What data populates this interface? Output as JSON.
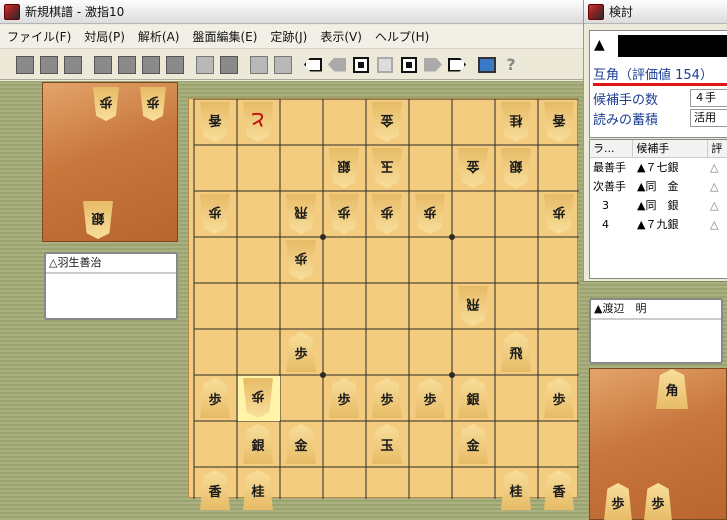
{
  "main_window": {
    "title": "新規棋譜 - 激指10"
  },
  "menu": [
    "ファイル(F)",
    "対局(P)",
    "解析(A)",
    "盤面編集(E)",
    "定跡(J)",
    "表示(V)",
    "ヘルプ(H)"
  ],
  "players": {
    "gote": "△羽生善治",
    "sente": "▲渡辺　明"
  },
  "gote_hand": [
    "歩",
    "歩",
    "銀"
  ],
  "sente_hand": [
    "角",
    "歩",
    "歩"
  ],
  "board": [
    [
      "g:香",
      "g:と",
      "",
      "",
      "g:金",
      "",
      "",
      "g:桂",
      "g:香"
    ],
    [
      "",
      "",
      "",
      "g:銀",
      "g:玉",
      "",
      "g:金",
      "g:銀",
      ""
    ],
    [
      "g:歩",
      "",
      "g:飛",
      "g:歩",
      "g:歩",
      "g:歩",
      "",
      "",
      "g:歩"
    ],
    [
      "",
      "",
      "g:歩",
      "",
      "",
      "",
      "",
      "",
      ""
    ],
    [
      "",
      "",
      "",
      "",
      "",
      "",
      "g:飛",
      "",
      ""
    ],
    [
      "",
      "",
      "歩",
      "",
      "",
      "",
      "",
      "飛",
      ""
    ],
    [
      "歩",
      "g:歩",
      "",
      "歩",
      "歩",
      "歩",
      "銀",
      "",
      "歩"
    ],
    [
      "",
      "銀",
      "金",
      "",
      "玉",
      "",
      "金",
      "",
      ""
    ],
    [
      "香",
      "桂",
      "",
      "",
      "",
      "",
      "",
      "桂",
      "香"
    ]
  ],
  "analysis": {
    "title": "検討",
    "eval_text": "互角（評価値 154）",
    "rows": [
      {
        "label": "候補手の数",
        "value": "４手"
      },
      {
        "label": "読みの蓄積",
        "value": "活用"
      }
    ],
    "list_headers": [
      "ラ...",
      "候補手",
      "評"
    ],
    "candidates": [
      {
        "rank": "最善手",
        "move": "▲７七銀",
        "sign": "△"
      },
      {
        "rank": "次善手",
        "move": "▲同　金",
        "sign": "△"
      },
      {
        "rank": "3",
        "move": "▲同　銀",
        "sign": "△"
      },
      {
        "rank": "4",
        "move": "▲７九銀",
        "sign": "△"
      }
    ]
  }
}
